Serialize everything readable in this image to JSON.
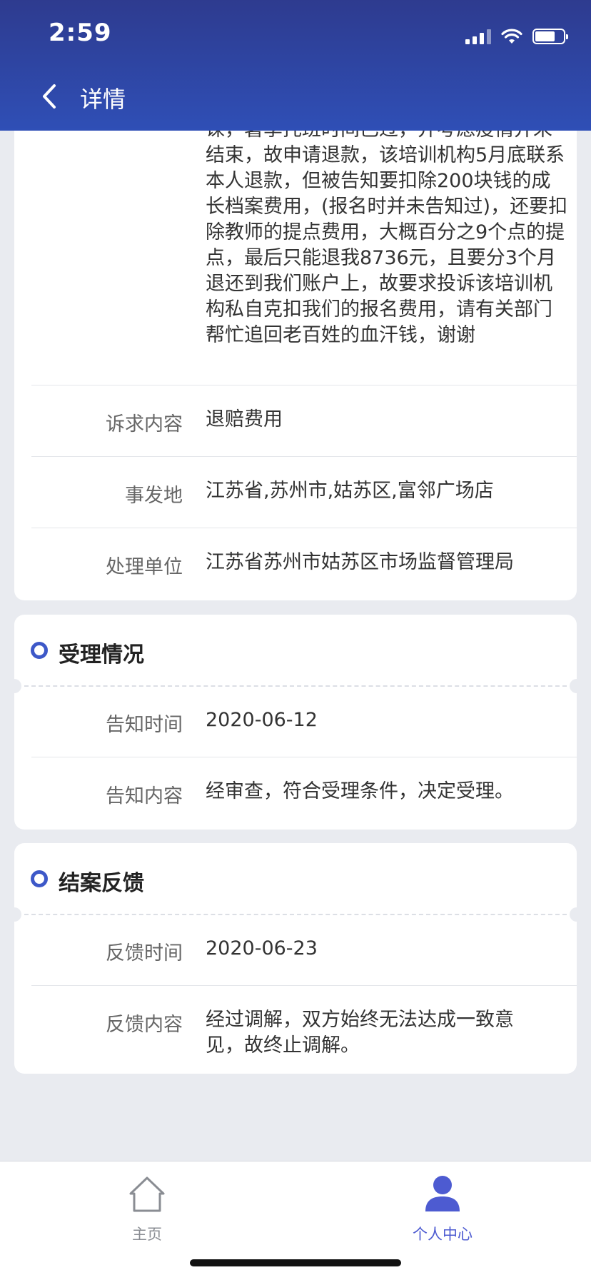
{
  "status_bar": {
    "time": "2:59",
    "battery_level": 0.7
  },
  "nav": {
    "title": "详情"
  },
  "complaint": {
    "text": "课，暑季托班时间已过，并考虑疫情并未结束，故申请退款，该培训机构5月底联系本人退款，但被告知要扣除200块钱的成长档案费用，(报名时并未告知过)，还要扣除教师的提点费用，大概百分之9个点的提点，最后只能退我8736元，且要分3个月退还到我们账户上，故要求投诉该培训机构私自克扣我们的报名费用，请有关部门帮忙追回老百姓的血汗钱，谢谢",
    "rows": [
      {
        "label": "诉求内容",
        "value": "退赔费用"
      },
      {
        "label": "事发地",
        "value": "江苏省,苏州市,姑苏区,富邻广场店"
      },
      {
        "label": "处理单位",
        "value": "江苏省苏州市姑苏区市场监督管理局"
      }
    ]
  },
  "acceptance": {
    "title": "受理情况",
    "rows": [
      {
        "label": "告知时间",
        "value": "2020-06-12"
      },
      {
        "label": "告知内容",
        "value": "经审查，符合受理条件，决定受理。"
      }
    ]
  },
  "closing": {
    "title": "结案反馈",
    "rows": [
      {
        "label": "反馈时间",
        "value": "2020-06-23"
      },
      {
        "label": "反馈内容",
        "value": "经过调解，双方始终无法达成一致意见，故终止调解。"
      }
    ]
  },
  "tabbar": {
    "home_label": "主页",
    "profile_label": "个人中心",
    "inactive_color": "#8a8d93",
    "active_color": "#4d5bd1"
  }
}
